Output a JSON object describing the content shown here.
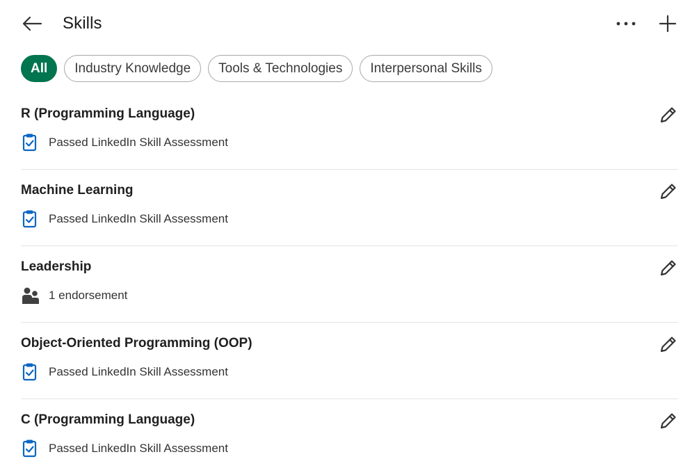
{
  "header": {
    "title": "Skills",
    "icons": {
      "back": "arrow-left-icon",
      "more": "more-horizontal-icon",
      "add": "plus-icon"
    }
  },
  "filters": [
    {
      "label": "All",
      "active": true
    },
    {
      "label": "Industry Knowledge",
      "active": false
    },
    {
      "label": "Tools & Technologies",
      "active": false
    },
    {
      "label": "Interpersonal Skills",
      "active": false
    }
  ],
  "skills": [
    {
      "name": "R (Programming Language)",
      "detail": "Passed LinkedIn Skill Assessment",
      "detail_icon": "clipboard-check-icon"
    },
    {
      "name": "Machine Learning",
      "detail": "Passed LinkedIn Skill Assessment",
      "detail_icon": "clipboard-check-icon"
    },
    {
      "name": "Leadership",
      "detail": "1 endorsement",
      "detail_icon": "people-icon"
    },
    {
      "name": "Object-Oriented Programming (OOP)",
      "detail": "Passed LinkedIn Skill Assessment",
      "detail_icon": "clipboard-check-icon"
    },
    {
      "name": "C (Programming Language)",
      "detail": "Passed LinkedIn Skill Assessment",
      "detail_icon": "clipboard-check-icon"
    }
  ],
  "colors": {
    "accent": "#01754f",
    "assessment_icon": "#0a66c2",
    "people_icon": "#404040"
  }
}
